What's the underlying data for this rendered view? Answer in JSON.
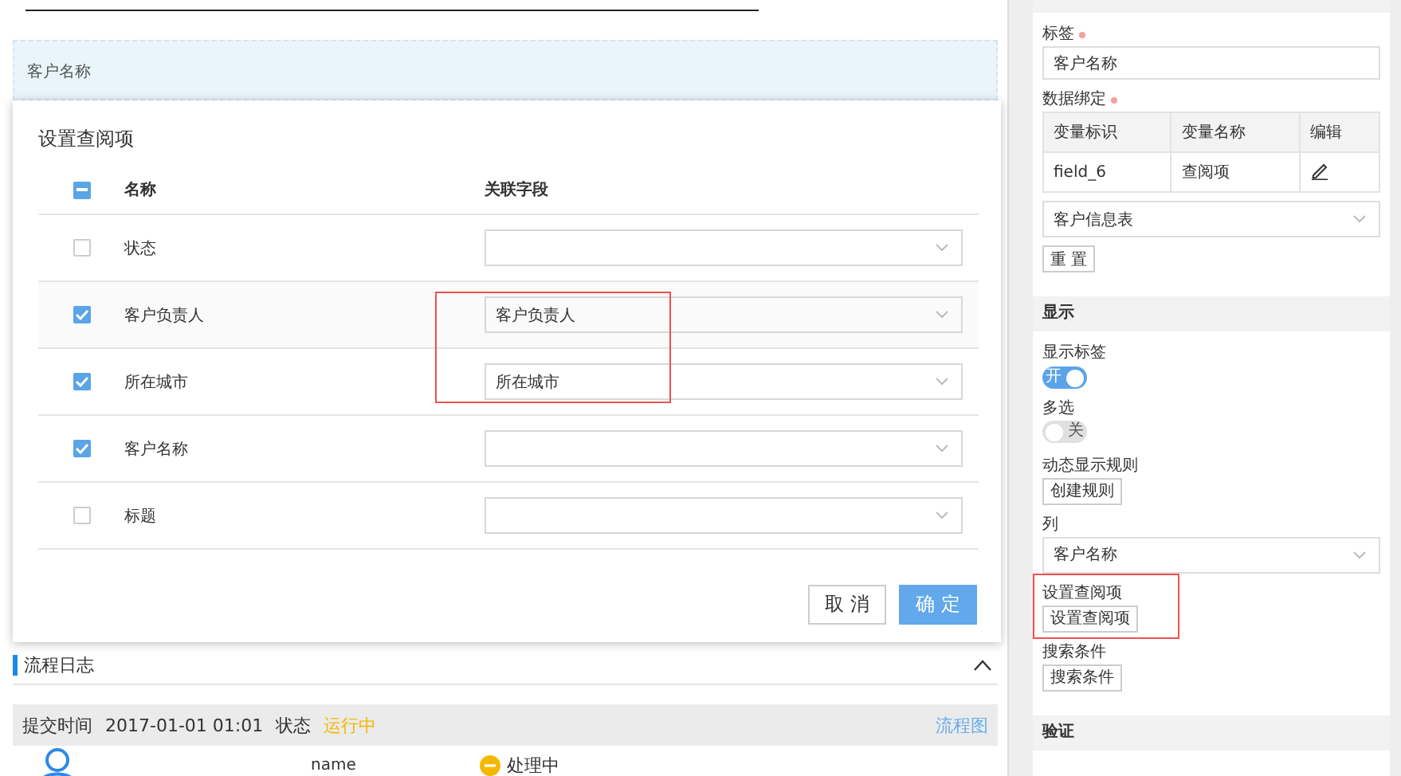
{
  "form_preview": {
    "field_label": "客户名称"
  },
  "lookup_dialog": {
    "title": "设置查阅项",
    "header_checkbox": {
      "indeterminate": true
    },
    "columns": [
      "名称",
      "关联字段"
    ],
    "rows": [
      {
        "name": "状态",
        "checked": false
      },
      {
        "name": "客户负责人",
        "checked": true,
        "field": "客户负责人",
        "hovered": true
      },
      {
        "name": "所在城市",
        "checked": true,
        "field": "所在城市"
      },
      {
        "name": "客户名称",
        "checked": true
      },
      {
        "name": "标题",
        "checked": false
      }
    ],
    "highlight_frame": true,
    "buttons": [
      {
        "kind": "cancel",
        "label": "取 消"
      },
      {
        "kind": "confirm",
        "label": "确 定"
      }
    ]
  },
  "process_log": {
    "title": "流程日志",
    "summary": {
      "time_label": "提交时间",
      "time": "2017-01-01 01:01",
      "status_label": "状态",
      "status": "运行中",
      "link": "流程图"
    },
    "entries": [
      {
        "name": "name",
        "status": "处理中"
      }
    ]
  },
  "properties": [
    {
      "kind": "group",
      "items": [
        {
          "kind": "input",
          "label": "标签",
          "required": true,
          "value": "客户名称"
        },
        {
          "kind": "table",
          "label": "数据绑定",
          "required": true,
          "columns": [
            "变量标识",
            "变量名称",
            "编辑"
          ],
          "rows": [
            [
              "field_6",
              "查阅项"
            ]
          ]
        },
        {
          "kind": "select",
          "value": "客户信息表"
        },
        {
          "kind": "button",
          "button": "重 置"
        }
      ]
    },
    {
      "kind": "section",
      "title": "显示",
      "items": [
        {
          "kind": "toggle",
          "label": "显示标签",
          "on": true,
          "text": "开"
        },
        {
          "kind": "toggle",
          "label": "多选",
          "on": false,
          "text": "关"
        },
        {
          "kind": "button",
          "label": "动态显示规则",
          "button": "创建规则"
        },
        {
          "kind": "select",
          "label": "列",
          "value": "客户名称"
        },
        {
          "kind": "button",
          "label": "设置查阅项",
          "button": "设置查阅项",
          "highlighted": true
        },
        {
          "kind": "button",
          "label": "搜索条件",
          "button": "搜索条件"
        }
      ]
    },
    {
      "kind": "section",
      "title": "验证"
    }
  ]
}
